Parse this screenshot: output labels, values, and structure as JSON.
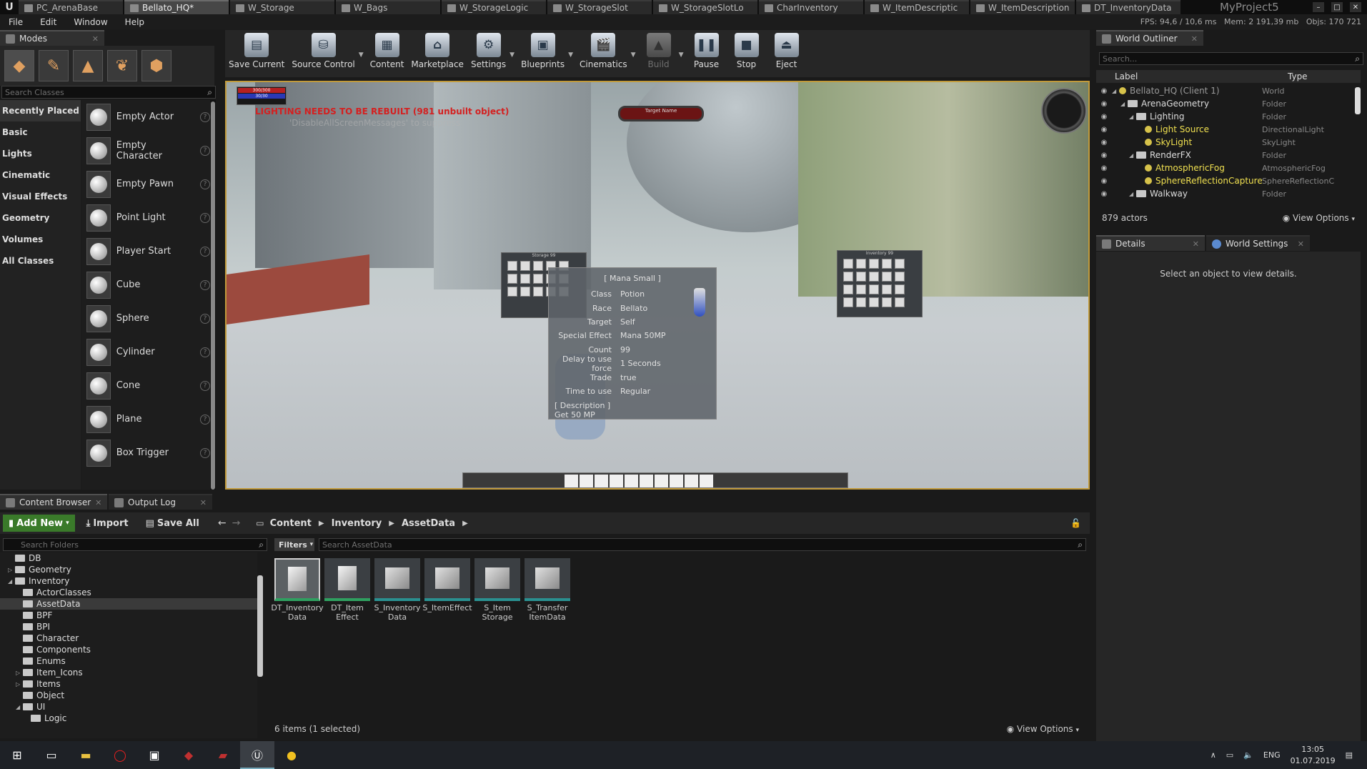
{
  "window": {
    "tabs": [
      "PC_ArenaBase",
      "Bellato_HQ*",
      "W_Storage",
      "W_Bags",
      "W_StorageLogic",
      "W_StorageSlot",
      "W_StorageSlotLo",
      "CharInventory",
      "W_ItemDescriptic",
      "W_ItemDescription",
      "DT_InventoryData"
    ],
    "project_name": "MyProject5"
  },
  "menu": [
    "File",
    "Edit",
    "Window",
    "Help"
  ],
  "stats": {
    "fps": "FPS: 94,6 / 10,6 ms",
    "mem": "Mem: 2 191,39 mb",
    "objs": "Objs: 170 721"
  },
  "modes": {
    "tab_label": "Modes",
    "search_placeholder": "Search Classes",
    "categories": [
      "Recently Placed",
      "Basic",
      "Lights",
      "Cinematic",
      "Visual Effects",
      "Geometry",
      "Volumes",
      "All Classes"
    ],
    "items": [
      "Empty Actor",
      "Empty Character",
      "Empty Pawn",
      "Point Light",
      "Player Start",
      "Cube",
      "Sphere",
      "Cylinder",
      "Cone",
      "Plane",
      "Box Trigger"
    ]
  },
  "toolbar": {
    "buttons": [
      {
        "label": "Save Current",
        "icon": "save-icon",
        "glyph": "▤"
      },
      {
        "label": "Source Control",
        "icon": "source-control-icon",
        "glyph": "⛁"
      },
      {
        "label": "Content",
        "icon": "content-icon",
        "glyph": "▦"
      },
      {
        "label": "Marketplace",
        "icon": "marketplace-icon",
        "glyph": "⌂"
      },
      {
        "label": "Settings",
        "icon": "settings-icon",
        "glyph": "⚙"
      },
      {
        "label": "Blueprints",
        "icon": "blueprints-icon",
        "glyph": "▣"
      },
      {
        "label": "Cinematics",
        "icon": "cinematics-icon",
        "glyph": "🎬"
      },
      {
        "label": "Build",
        "icon": "build-icon",
        "glyph": "▲"
      },
      {
        "label": "Pause",
        "icon": "pause-icon",
        "glyph": "❚❚"
      },
      {
        "label": "Stop",
        "icon": "stop-icon",
        "glyph": "■"
      },
      {
        "label": "Eject",
        "icon": "eject-icon",
        "glyph": "⏏"
      }
    ]
  },
  "viewport": {
    "hp": "300/300",
    "mp": "30/30",
    "lighting_warning": "LIGHTING NEEDS TO BE REBUILT (981 unbuilt object)",
    "suppress_hint": "'DisableAllScreenMessages' to suppress",
    "target_name": "Target Name",
    "storage_title": "Storage 99",
    "inventory_title": "Inventory 99",
    "tooltip": {
      "title": "[ Mana Small ]",
      "rows": [
        {
          "k": "Class",
          "v": "Potion"
        },
        {
          "k": "Race",
          "v": "Bellato"
        },
        {
          "k": "Target",
          "v": "Self"
        },
        {
          "k": "Special Effect",
          "v": "Mana 50MP"
        },
        {
          "k": "Count",
          "v": "99"
        },
        {
          "k": "Delay to use force",
          "v": "1 Seconds"
        },
        {
          "k": "Trade",
          "v": "true"
        },
        {
          "k": "Time to use",
          "v": "Regular"
        }
      ],
      "desc_label": "[ Description ]",
      "desc": "Get 50 MP"
    }
  },
  "content_browser": {
    "tab_label": "Content Browser",
    "output_tab": "Output Log",
    "add_new": "Add New",
    "import": "Import",
    "save_all": "Save All",
    "path": [
      "Content",
      "Inventory",
      "AssetData"
    ],
    "folder_search_placeholder": "Search Folders",
    "folders": [
      {
        "name": "DB",
        "indent": 1,
        "tw": ""
      },
      {
        "name": "Geometry",
        "indent": 1,
        "tw": "▷"
      },
      {
        "name": "Inventory",
        "indent": 1,
        "tw": "◢"
      },
      {
        "name": "ActorClasses",
        "indent": 2,
        "tw": ""
      },
      {
        "name": "AssetData",
        "indent": 2,
        "tw": "",
        "sel": true
      },
      {
        "name": "BPF",
        "indent": 2,
        "tw": ""
      },
      {
        "name": "BPI",
        "indent": 2,
        "tw": ""
      },
      {
        "name": "Character",
        "indent": 2,
        "tw": ""
      },
      {
        "name": "Components",
        "indent": 2,
        "tw": ""
      },
      {
        "name": "Enums",
        "indent": 2,
        "tw": ""
      },
      {
        "name": "Item_Icons",
        "indent": 2,
        "tw": "▷"
      },
      {
        "name": "Items",
        "indent": 2,
        "tw": "▷"
      },
      {
        "name": "Object",
        "indent": 2,
        "tw": ""
      },
      {
        "name": "UI",
        "indent": 2,
        "tw": "◢"
      },
      {
        "name": "Logic",
        "indent": 3,
        "tw": ""
      }
    ],
    "filters_label": "Filters",
    "asset_search_placeholder": "Search AssetData",
    "assets": [
      {
        "name": "DT_Inventory Data",
        "kind": "table",
        "sel": true
      },
      {
        "name": "DT_Item Effect",
        "kind": "table"
      },
      {
        "name": "S_Inventory Data",
        "kind": "struct"
      },
      {
        "name": "S_ItemEffect",
        "kind": "struct"
      },
      {
        "name": "S_Item Storage",
        "kind": "struct"
      },
      {
        "name": "S_Transfer ItemData",
        "kind": "struct"
      }
    ],
    "status": "6 items (1 selected)",
    "view_options": "View Options"
  },
  "outliner": {
    "tab_label": "World Outliner",
    "search_placeholder": "Search...",
    "col_label": "Label",
    "col_type": "Type",
    "rows": [
      {
        "label": "Bellato_HQ (Client 1)",
        "type": "World",
        "indent": 0,
        "tw": "◢",
        "color": "#9a9a9a"
      },
      {
        "label": "ArenaGeometry",
        "type": "Folder",
        "indent": 1,
        "tw": "◢",
        "color": "#dddddd",
        "folder": true
      },
      {
        "label": "Lighting",
        "type": "Folder",
        "indent": 2,
        "tw": "◢",
        "color": "#dddddd",
        "folder": true
      },
      {
        "label": "Light Source",
        "type": "DirectionalLight",
        "indent": 3,
        "tw": "",
        "color": "#f0e050"
      },
      {
        "label": "SkyLight",
        "type": "SkyLight",
        "indent": 3,
        "tw": "",
        "color": "#f0e050"
      },
      {
        "label": "RenderFX",
        "type": "Folder",
        "indent": 2,
        "tw": "◢",
        "color": "#dddddd",
        "folder": true
      },
      {
        "label": "AtmosphericFog",
        "type": "AtmosphericFog",
        "indent": 3,
        "tw": "",
        "color": "#f0e050"
      },
      {
        "label": "SphereReflectionCapture",
        "type": "SphereReflectionC",
        "indent": 3,
        "tw": "",
        "color": "#f0e050"
      },
      {
        "label": "Walkway",
        "type": "Folder",
        "indent": 2,
        "tw": "◢",
        "color": "#dddddd",
        "folder": true
      }
    ],
    "actors": "879 actors",
    "view_options": "View Options"
  },
  "details": {
    "tab_label": "Details",
    "world_settings_tab": "World Settings",
    "empty_msg": "Select an object to view details."
  },
  "taskbar": {
    "lang": "ENG",
    "time": "13:05",
    "date": "01.07.2019"
  }
}
